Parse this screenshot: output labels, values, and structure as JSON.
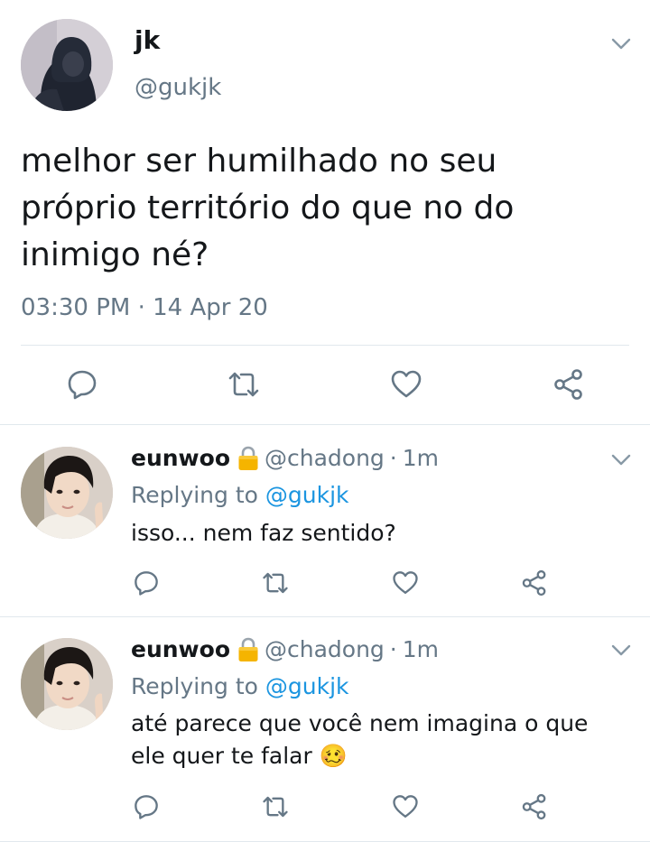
{
  "main_tweet": {
    "name": "jk",
    "handle": "@gukjk",
    "text": "melhor ser humilhado no seu\npróprio território do que no do\ninimigo né?",
    "timestamp": "03:30 PM · 14 Apr 20"
  },
  "replies": [
    {
      "name": "eunwoo",
      "handle": "@chadong",
      "dot": "·",
      "time": "1m",
      "replying_prefix": "Replying to",
      "replying_to": "@gukjk",
      "text": "isso... nem faz sentido?"
    },
    {
      "name": "eunwoo",
      "handle": "@chadong",
      "dot": "·",
      "time": "1m",
      "replying_prefix": "Replying to",
      "replying_to": "@gukjk",
      "text": "até parece que você nem imagina o que ele quer te falar",
      "emoji": "🥴"
    }
  ],
  "icons": {
    "reply": "reply-icon",
    "retweet": "retweet-icon",
    "like": "heart-icon",
    "share": "share-icon",
    "more": "chevron-down-icon",
    "protected": "lock-icon"
  },
  "colors": {
    "text": "#14171a",
    "secondary": "#657786",
    "link": "#1b95e0",
    "divider": "#e1e8ed"
  }
}
